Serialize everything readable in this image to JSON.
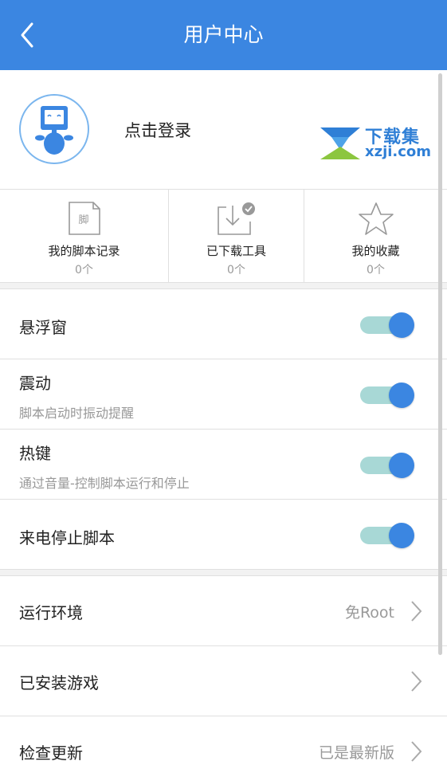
{
  "header": {
    "title": "用户中心",
    "back_icon": "chevron-left-icon"
  },
  "profile": {
    "login_text": "点击登录",
    "avatar_icon": "robot-avatar-icon",
    "watermark": {
      "cn": "下载集",
      "en": "xzji.com"
    }
  },
  "stats": [
    {
      "label": "我的脚本记录",
      "count": "0个",
      "icon": "script-file-icon",
      "icon_text": "脚"
    },
    {
      "label": "已下载工具",
      "count": "0个",
      "icon": "download-tray-icon"
    },
    {
      "label": "我的收藏",
      "count": "0个",
      "icon": "star-outline-icon"
    }
  ],
  "settings": [
    {
      "title": "悬浮窗",
      "subtitle": "",
      "enabled": true
    },
    {
      "title": "震动",
      "subtitle": "脚本启动时振动提醒",
      "enabled": true
    },
    {
      "title": "热键",
      "subtitle": "通过音量-控制脚本运行和停止",
      "enabled": true
    },
    {
      "title": "来电停止脚本",
      "subtitle": "",
      "enabled": true
    }
  ],
  "nav": [
    {
      "title": "运行环境",
      "value": "免Root"
    },
    {
      "title": "已安装游戏",
      "value": ""
    },
    {
      "title": "检查更新",
      "value": "已是最新版"
    }
  ],
  "colors": {
    "accent": "#3b86e1",
    "toggle_track": "#a8d8d6",
    "divider": "#e0e0e0"
  }
}
